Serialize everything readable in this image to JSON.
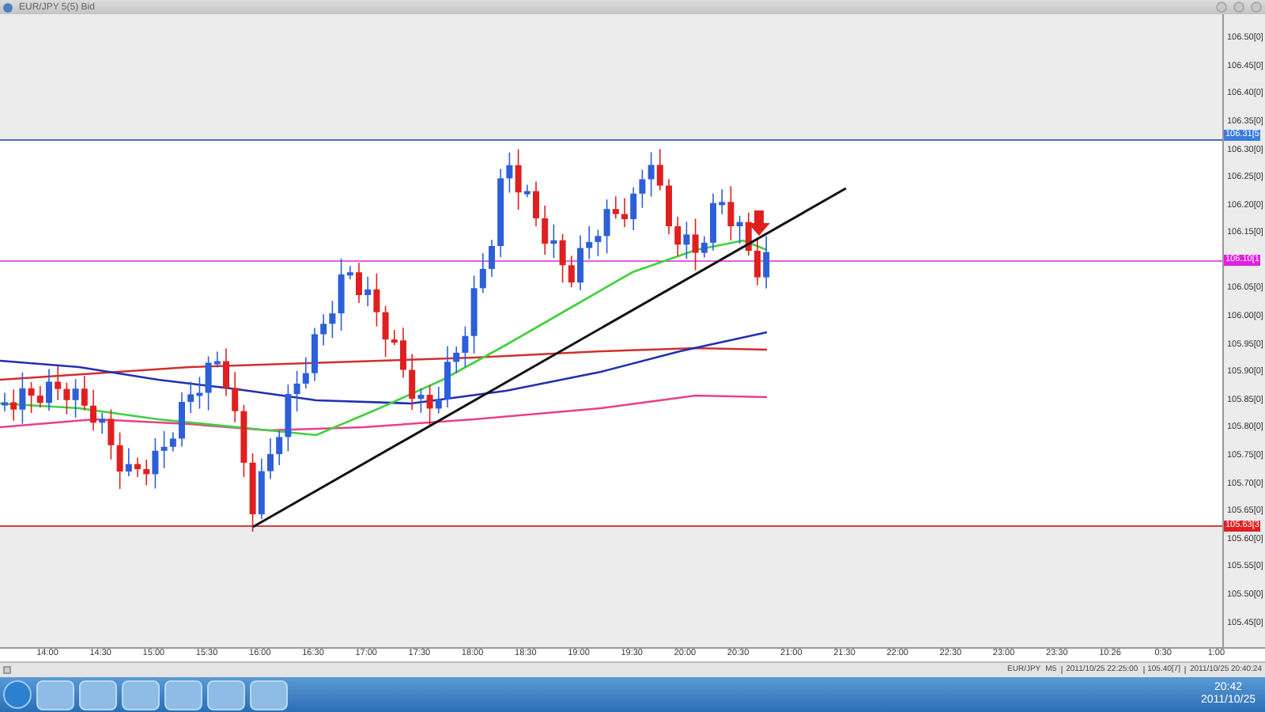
{
  "window": {
    "title": "EUR/JPY 5(5) Bid"
  },
  "price_axis": {
    "labels": [
      "106.50[0]",
      "106.45[0]",
      "106.40[0]",
      "106.35[0]",
      "106.30[0]",
      "106.25[0]",
      "106.20[0]",
      "106.15[0]",
      "106.05[0]",
      "106.00[0]",
      "105.95[0]",
      "105.90[0]",
      "105.85[0]",
      "105.80[0]",
      "105.75[0]",
      "105.70[0]",
      "105.65[0]",
      "105.60[0]",
      "105.55[0]",
      "105.50[0]",
      "105.45[0]"
    ]
  },
  "price_lines": [
    {
      "label": "106.31[5",
      "color": "#3b7be0"
    },
    {
      "label": "106.10[1",
      "color": "#e020e0"
    },
    {
      "label": "105.63[3",
      "color": "#e02020"
    }
  ],
  "time_axis": {
    "labels": [
      "14:00",
      "14:30",
      "15:00",
      "15:30",
      "16:00",
      "16:30",
      "17:00",
      "17:30",
      "18:00",
      "18:30",
      "19:00",
      "19:30",
      "20:00",
      "20:30",
      "21:00",
      "21:30",
      "22:00",
      "22:30",
      "23:00",
      "23:30",
      "10:26",
      "0:30",
      "1:00"
    ]
  },
  "toolbar": {
    "symbol": "EUR/JPY",
    "timeframe": "M5",
    "status": [
      "2011/10/25 22:25:00",
      "105.40[7]",
      "2011/10/25 20:40:24"
    ]
  },
  "taskbar": {
    "time": "20:42",
    "date": "2011/10/25"
  }
}
